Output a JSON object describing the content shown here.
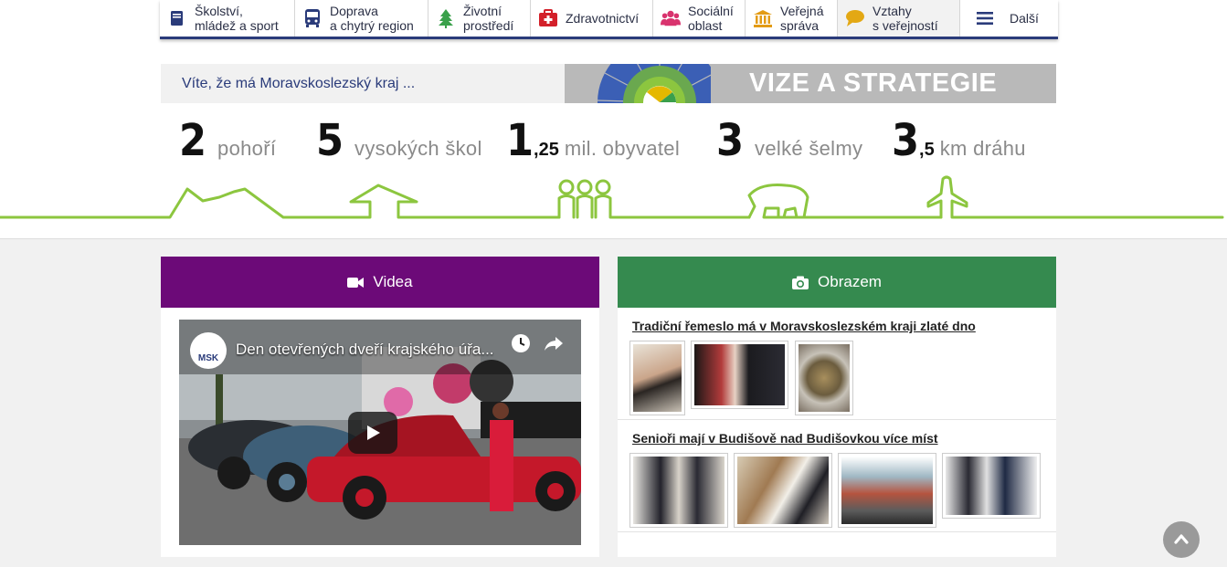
{
  "nav": {
    "items": [
      {
        "line1": "Školství,",
        "line2": "mládež a sport",
        "icon": "book-icon",
        "color": "#2a3b7a"
      },
      {
        "line1": "Doprava",
        "line2": "a chytrý region",
        "icon": "bus-icon",
        "color": "#2a3b7a"
      },
      {
        "line1": "Životní",
        "line2": "prostředí",
        "icon": "tree-icon",
        "color": "#3aa14b"
      },
      {
        "line1": "Zdravotnictví",
        "line2": "",
        "icon": "first-aid-icon",
        "color": "#d3202a"
      },
      {
        "line1": "Sociální",
        "line2": "oblast",
        "icon": "people-icon",
        "color": "#d9336e"
      },
      {
        "line1": "Veřejná",
        "line2": "správa",
        "icon": "institution-icon",
        "color": "#e39b14"
      },
      {
        "line1": "Vztahy",
        "line2": "s veřejností",
        "icon": "speech-bubble-icon",
        "color": "#e3a814"
      },
      {
        "line1": "Další",
        "line2": "",
        "icon": "menu-icon",
        "color": "#2a3b7a"
      }
    ]
  },
  "banner": {
    "know_text": "Víte, že má Moravskoslezský kraj ...",
    "vize_title": "VIZE A STRATEGIE"
  },
  "stats": [
    {
      "num": "2",
      "sub": "",
      "text": "pohoří"
    },
    {
      "num": "5",
      "sub": "",
      "text": "vysokých škol"
    },
    {
      "num": "1",
      "sub": ",25",
      "text": "mil. obyvatel"
    },
    {
      "num": "3",
      "sub": "",
      "text": "velké šelmy"
    },
    {
      "num": "3",
      "sub": ",5",
      "text": "km dráhu"
    }
  ],
  "videa": {
    "heading": "Videa",
    "video_title": "Den otevřených dveří krajského úřa...",
    "channel_logo": "MSK"
  },
  "obrazem": {
    "heading": "Obrazem",
    "albums": [
      {
        "title": "Tradiční řemeslo má v Moravskoslezském kraji zlaté dno"
      },
      {
        "title": "Senioři mají v Budišově nad Budišovkou více míst"
      }
    ]
  },
  "colors": {
    "nav_accent": "#2a3b7a",
    "videa": "#6c0a78",
    "obrazem": "#358a4f",
    "landscape_line": "#8cc63f"
  }
}
